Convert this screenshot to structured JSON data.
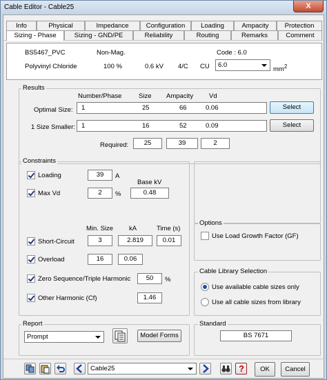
{
  "window": {
    "title": "Cable Editor - Cable25",
    "close_glyph": "X"
  },
  "tabs_row1": [
    "Info",
    "Physical",
    "Impedance",
    "Configuration",
    "Loading",
    "Ampacity",
    "Protection"
  ],
  "tabs_row2": [
    "Sizing - Phase",
    "Sizing - GND/PE",
    "Reliability",
    "Routing",
    "Remarks",
    "Comment"
  ],
  "cable": {
    "type": "BS5467_PVC",
    "magnetic": "Non-Mag.",
    "code_label": "Code : 6.0",
    "insulation": "Polyvinyl Chloride",
    "percent": "100 %",
    "kv": "0.6 kV",
    "conductors": "4/C",
    "material": "CU",
    "size": "6.0",
    "unit": "mm",
    "unit_exp": "2"
  },
  "results": {
    "title": "Results",
    "headers": [
      "Number/Phase",
      "Size",
      "Ampacity",
      "Vd"
    ],
    "optimal": {
      "label": "Optimal Size:",
      "n": "1",
      "size": "25",
      "amp": "66",
      "vd": "0.06",
      "btn": "Select"
    },
    "smaller": {
      "label": "1 Size Smaller:",
      "n": "1",
      "size": "16",
      "amp": "52",
      "vd": "0.09",
      "btn": "Select"
    },
    "required": {
      "label": "Required:",
      "size": "25",
      "amp": "39",
      "vd": "2"
    }
  },
  "constraints": {
    "title": "Constraints",
    "loading": {
      "label": "Loading",
      "value": "39",
      "unit": "A"
    },
    "basekv": {
      "label": "Base kV",
      "value": "0.48"
    },
    "maxvd": {
      "label": "Max Vd",
      "value": "2",
      "unit": "%"
    },
    "sc_headers": [
      "Min. Size",
      "kA",
      "Time (s)"
    ],
    "short_circuit": {
      "label": "Short-Circuit",
      "min": "3",
      "ka": "2.819",
      "time": "0.01"
    },
    "overload": {
      "label": "Overload",
      "v1": "16",
      "v2": "0.06"
    },
    "zero_seq": {
      "label": "Zero Sequence/Triple Harmonic",
      "value": "50",
      "unit": "%"
    },
    "other_harm": {
      "label": "Other Harmonic (Cf)",
      "value": "1.46"
    }
  },
  "options": {
    "title": "Options",
    "load_growth": "Use Load Growth Factor (GF)"
  },
  "library": {
    "title": "Cable Library Selection",
    "opt1": "Use available cable sizes only",
    "opt2": "Use all cable sizes from library"
  },
  "report": {
    "title": "Report",
    "value": "Prompt",
    "model_forms": "Model Forms"
  },
  "standard": {
    "title": "Standard",
    "value": "BS 7671"
  },
  "bottom": {
    "cable_name": "Cable25",
    "ok": "OK",
    "cancel": "Cancel",
    "help": "?"
  }
}
